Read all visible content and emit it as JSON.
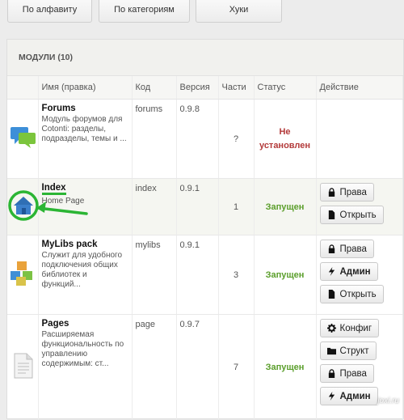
{
  "tabs": [
    {
      "label": "По алфавиту"
    },
    {
      "label": "По категориям"
    },
    {
      "label": "Хуки"
    }
  ],
  "panel": {
    "title": "МОДУЛИ (10)"
  },
  "columns": {
    "name": "Имя (правка)",
    "code": "Код",
    "version": "Версия",
    "parts": "Части",
    "status": "Статус",
    "action": "Действие"
  },
  "modules": [
    {
      "name": "Forums",
      "desc": "Модуль форумов для Cotonti: разделы, подразделы, темы и ...",
      "code": "forums",
      "version": "0.9.8",
      "parts": "?",
      "status": "Не установлен",
      "icon": "chat-bubbles-icon"
    },
    {
      "name": "Index",
      "desc": "Home Page",
      "code": "index",
      "version": "0.9.1",
      "parts": "1",
      "status": "Запущен",
      "icon": "home-icon"
    },
    {
      "name": "MyLibs pack",
      "desc": "Служит для удобного подключения общих библиотек и функций...",
      "code": "mylibs",
      "version": "0.9.1",
      "parts": "3",
      "status": "Запущен",
      "icon": "cubes-icon"
    },
    {
      "name": "Pages",
      "desc": "Расширяемая функциональность по управлению содержимым: ст...",
      "code": "page",
      "version": "0.9.7",
      "parts": "7",
      "status": "Запущен",
      "icon": "document-icon"
    }
  ],
  "buttons": {
    "rights": "Права",
    "open": "Открыть",
    "admin": "Админ",
    "config": "Конфиг",
    "struct": "Структ"
  },
  "colors": {
    "running": "#5a9e2a",
    "not_installed": "#b33a3a",
    "highlight": "#2bb534"
  },
  "watermark": "joxi.ru"
}
